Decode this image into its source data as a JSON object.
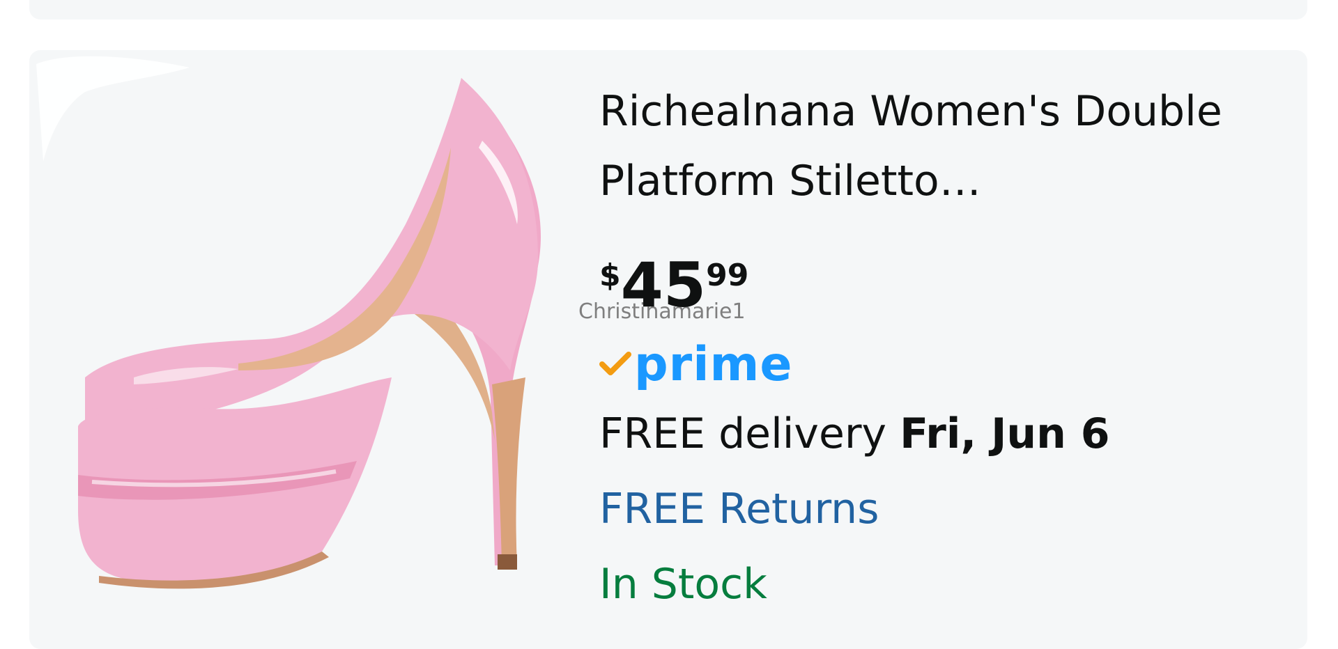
{
  "product": {
    "title": "Richealnana Women's Double Platform Stiletto…",
    "image_alt": "pink-platform-stiletto-pump",
    "price": {
      "symbol": "$",
      "whole": "45",
      "fraction": "99"
    },
    "watermark": "Christinamarie1",
    "prime": {
      "label": "prime",
      "check_color": "#f39c12",
      "color": "#1a98ff"
    },
    "delivery": {
      "prefix": "FREE delivery ",
      "date": "Fri, Jun 6"
    },
    "returns": "FREE Returns",
    "stock": "In Stock"
  },
  "colors": {
    "card_bg": "#f5f7f8",
    "text": "#0f1111",
    "link": "#2162a1",
    "stock": "#067d3e",
    "shoe_pink": "#f2b3cf"
  }
}
